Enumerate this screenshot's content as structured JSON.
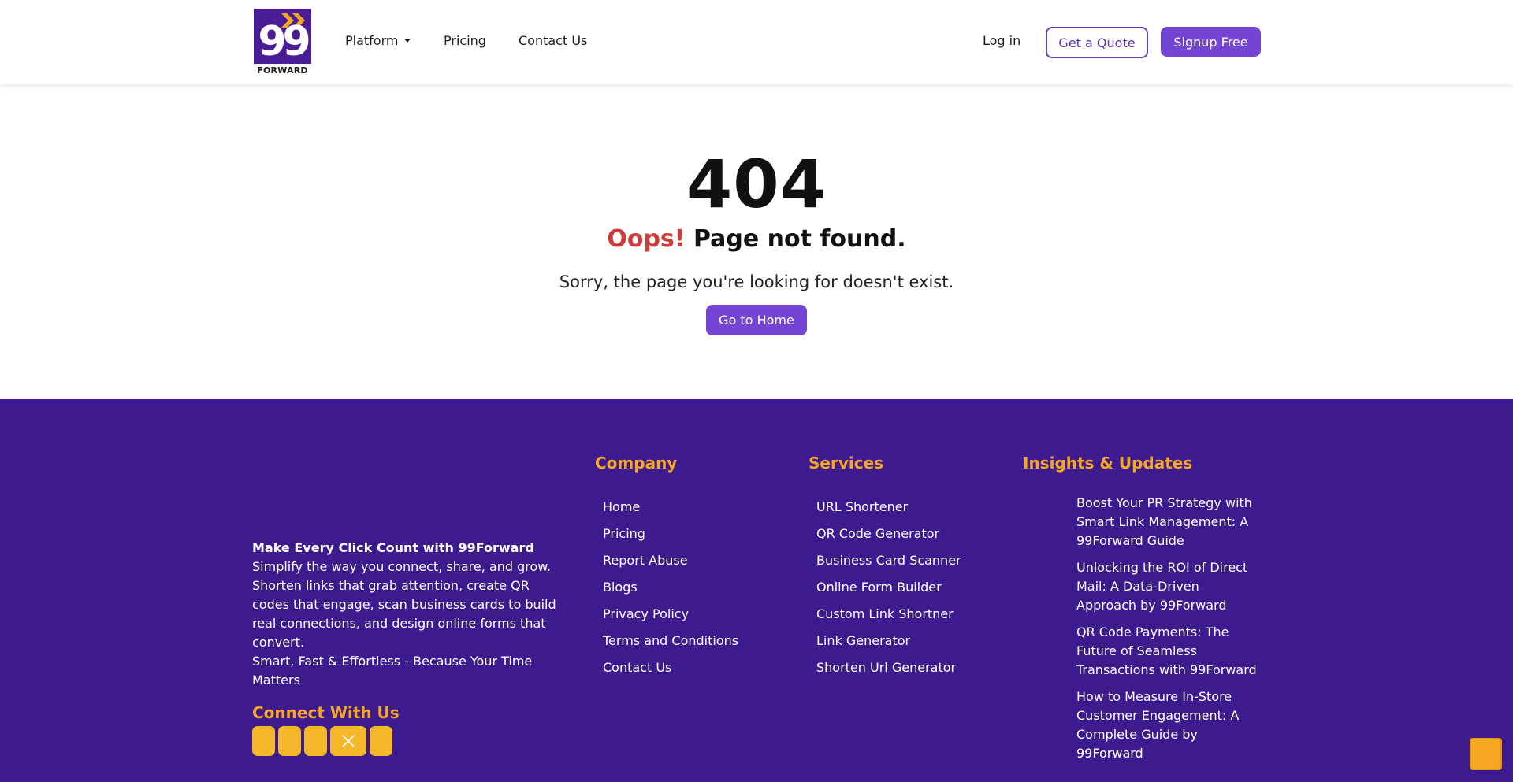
{
  "header": {
    "logo_text": "99",
    "logo_word": "FORWARD",
    "nav": [
      {
        "label": "Platform"
      },
      {
        "label": "Pricing"
      },
      {
        "label": "Contact Us"
      }
    ],
    "login_label": "Log in",
    "quote_label": "Get a Quote",
    "signup_label": "Signup Free"
  },
  "error": {
    "code": "404",
    "oops": "Oops!",
    "heading": "Page not found.",
    "message": "Sorry, the page you're looking for doesn't exist.",
    "home_label": "Go to Home"
  },
  "footer": {
    "tagline": "Make Every Click Count with 99Forward",
    "description": "Simplify the way you connect, share, and grow. Shorten links that grab attention, create QR codes that engage, scan business cards to build real connections, and design online forms that convert.",
    "motto": "Smart, Fast & Effortless - Because Your Time Matters",
    "connect_title": "Connect With Us",
    "company": {
      "title": "Company",
      "items": [
        "Home",
        "Pricing",
        "Report Abuse",
        "Blogs",
        "Privacy Policy",
        "Terms and Conditions",
        "Contact Us"
      ]
    },
    "services": {
      "title": "Services",
      "items": [
        "URL Shortener",
        "QR Code Generator",
        "Business Card Scanner",
        "Online Form Builder",
        "Custom Link Shortner",
        "Link Generator",
        "Shorten Url Generator"
      ]
    },
    "insights": {
      "title": "Insights & Updates",
      "items": [
        "Boost Your PR Strategy with Smart Link Management: A 99Forward Guide",
        "Unlocking the ROI of Direct Mail: A Data-Driven Approach by 99Forward",
        "QR Code Payments: The Future of Seamless Transactions with 99Forward",
        "How to Measure In-Store Customer Engagement: A Complete Guide by 99Forward"
      ]
    }
  },
  "colors": {
    "brand_purple": "#7444d2",
    "footer_bg": "#3d1b8e",
    "accent_orange": "#f5a623",
    "error_red": "#cf3a3a"
  }
}
